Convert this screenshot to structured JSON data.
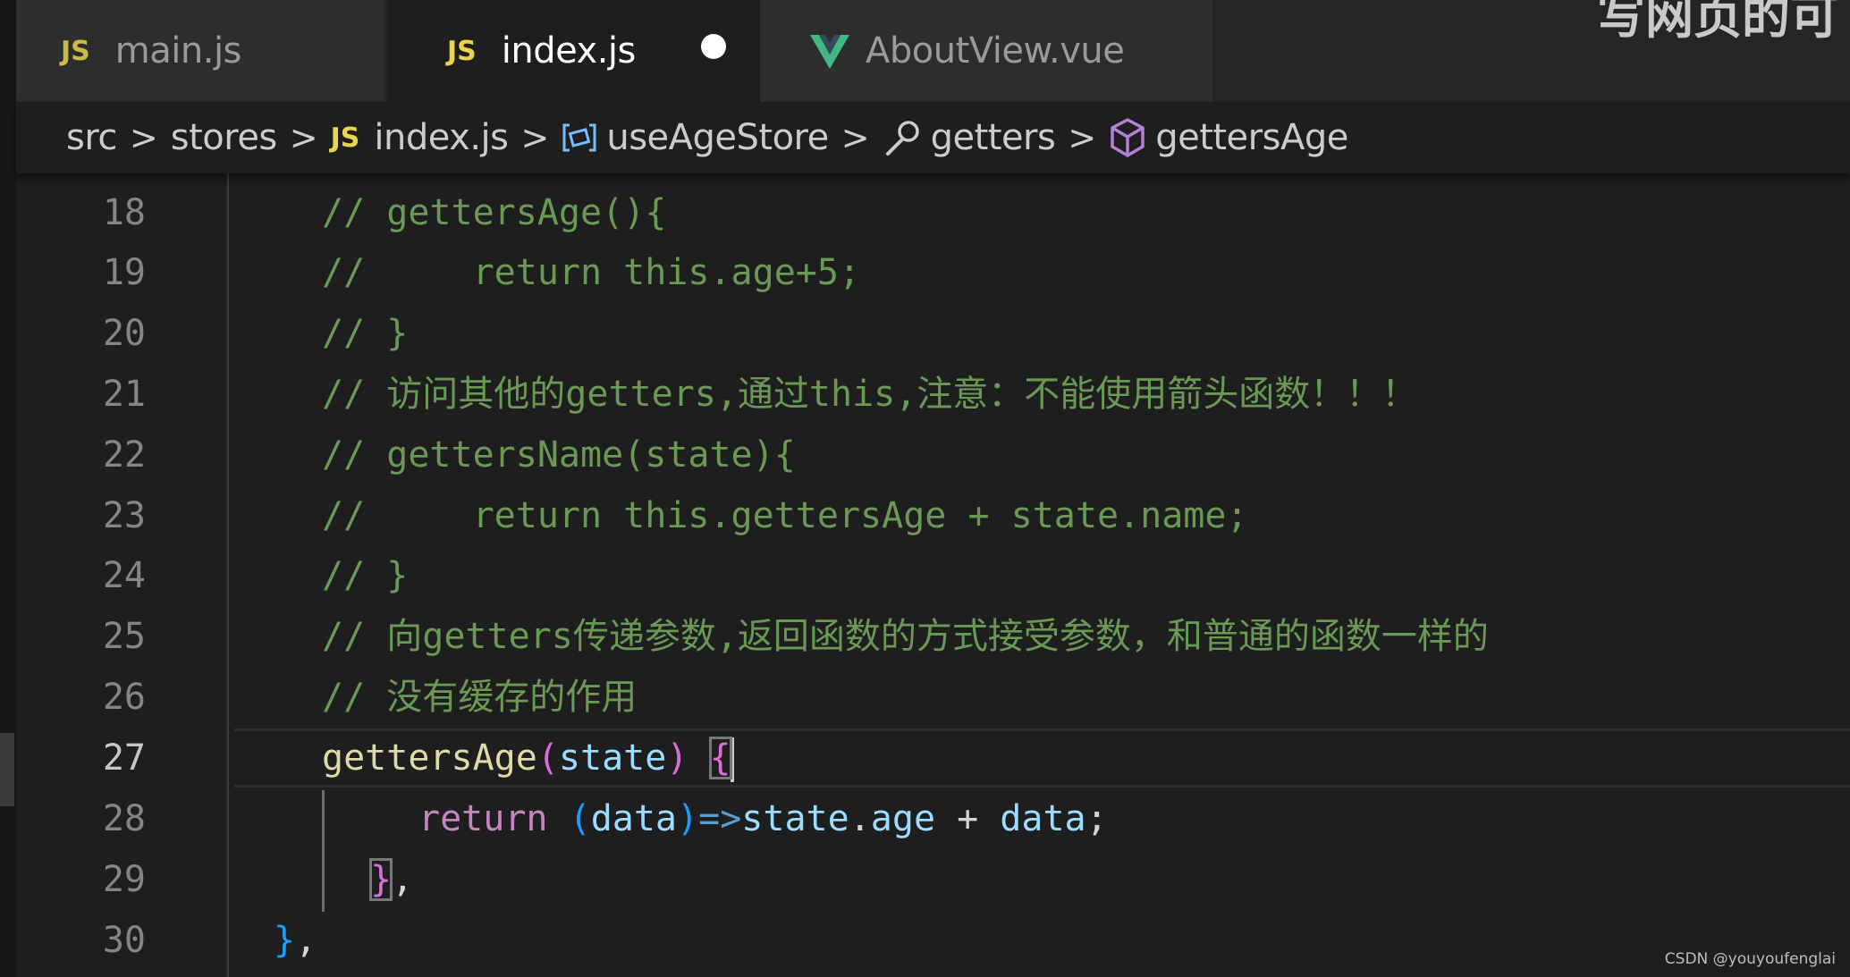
{
  "tabs": [
    {
      "icon": "js-icon",
      "label": "main.js",
      "state": "inactive"
    },
    {
      "icon": "js-icon",
      "label": "index.js",
      "state": "active",
      "modified": true
    },
    {
      "icon": "vue-icon",
      "label": "AboutView.vue",
      "state": "inactive"
    }
  ],
  "tab_icon_text": {
    "js": "JS"
  },
  "watermark_top": "写网页的可",
  "breadcrumb": {
    "items": [
      "src",
      "stores",
      "index.js",
      "useAgeStore",
      "getters",
      "gettersAge"
    ],
    "separator": ">"
  },
  "editor": {
    "current_line": 27,
    "line_numbers": [
      "18",
      "19",
      "20",
      "21",
      "22",
      "23",
      "24",
      "25",
      "26",
      "27",
      "28",
      "29",
      "30"
    ],
    "lines": {
      "l18": "// gettersAge(){",
      "l19": "//     return this.age+5;",
      "l20": "// }",
      "l21": "// 访问其他的getters,通过this,注意：不能使用箭头函数！！！",
      "l22": "// gettersName(state){",
      "l23": "//     return this.gettersAge + state.name;",
      "l24": "// }",
      "l25": "// 向getters传递参数,返回函数的方式接受参数，和普通的函数一样的",
      "l26": "// 没有缓存的作用",
      "l27": {
        "fn": "gettersAge",
        "p_open": "(",
        "param": "state",
        "p_close": ")",
        "space": " ",
        "brace": "{"
      },
      "l28": {
        "kw": "return",
        "space1": " ",
        "p_open": "(",
        "param": "data",
        "p_close": ")",
        "arrow": "=>",
        "obj": "state",
        "dot": ".",
        "prop": "age",
        "op": " + ",
        "arg": "data",
        "semi": ";"
      },
      "l29": {
        "brace": "}",
        "comma": ","
      },
      "l30": {
        "brace": "}",
        "comma": ","
      }
    }
  },
  "credit": "CSDN @youyoufenglai",
  "colors": {
    "background": "#1e1e1e",
    "comment": "#6a9955",
    "function": "#dcdcaa",
    "variable": "#9cdcfe",
    "keyword": "#c586c0",
    "bracket_level1": "#ffd700",
    "bracket_level2": "#da70d6",
    "bracket_level3": "#179fff",
    "js_icon": "#e8d44d",
    "vue_icon": "#41b883"
  }
}
